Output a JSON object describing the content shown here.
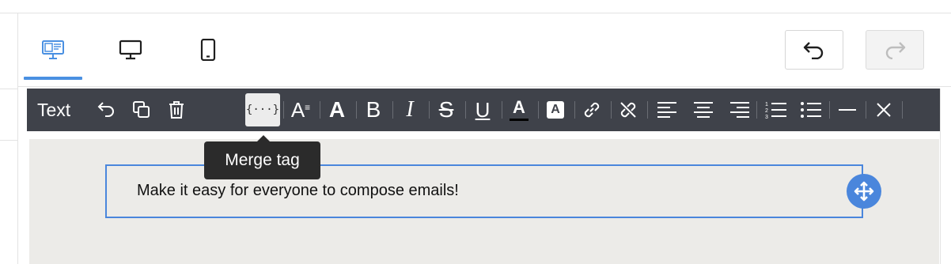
{
  "view_switcher": {
    "items": [
      {
        "name": "design-view",
        "icon": "monitor-code-icon",
        "active": true
      },
      {
        "name": "desktop-preview",
        "icon": "desktop-icon",
        "active": false
      },
      {
        "name": "mobile-preview",
        "icon": "mobile-icon",
        "active": false
      }
    ]
  },
  "history": {
    "undo_icon": "undo-icon",
    "redo_icon": "redo-icon",
    "redo_disabled": true
  },
  "toolbar": {
    "label": "Text",
    "buttons": [
      "undo-icon",
      "duplicate-icon",
      "trash-icon",
      "merge-tag-icon",
      "font-size-icon",
      "font-family-icon",
      "bold-icon",
      "italic-icon",
      "strikethrough-icon",
      "underline-icon",
      "text-color-icon",
      "background-color-icon",
      "link-icon",
      "unlink-icon",
      "align-left-icon",
      "align-center-icon",
      "align-right-icon",
      "ordered-list-icon",
      "bullet-list-icon",
      "horizontal-rule-icon",
      "clear-format-icon"
    ],
    "active_button": "merge-tag-icon",
    "merge_tag_glyph": "{···}",
    "font_size_glyph": "A",
    "font_family_glyph": "A",
    "bold_glyph": "B",
    "italic_glyph": "I",
    "strike_glyph": "S",
    "underline_glyph": "U",
    "text_color_glyph": "A",
    "bg_color_glyph": "A"
  },
  "tooltip": {
    "text": "Merge tag"
  },
  "content": {
    "text": "Make it easy for everyone to compose emails!"
  },
  "colors": {
    "accent": "#4a90e2",
    "toolbar_bg": "#3f424a",
    "canvas_bg": "#ecebe8"
  }
}
